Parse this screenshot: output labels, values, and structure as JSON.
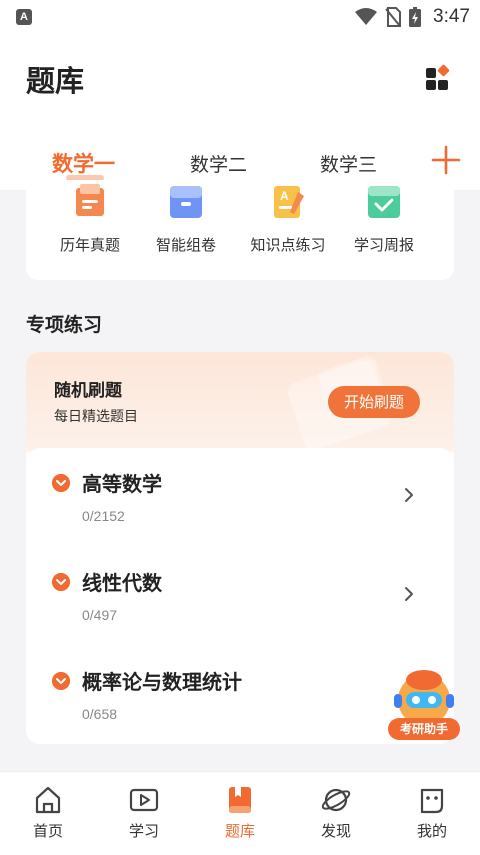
{
  "status_bar": {
    "time": "3:47",
    "app_indicator": "A"
  },
  "header": {
    "title": "题库"
  },
  "tabs": [
    {
      "label": "数学一",
      "active": true
    },
    {
      "label": "数学二",
      "active": false
    },
    {
      "label": "数学三",
      "active": false
    }
  ],
  "quick_actions": [
    {
      "label": "历年真题",
      "icon": "exam-paper-icon"
    },
    {
      "label": "智能组卷",
      "icon": "folder-box-icon"
    },
    {
      "label": "知识点练习",
      "icon": "notebook-a-icon"
    },
    {
      "label": "学习周报",
      "icon": "report-check-icon"
    }
  ],
  "section": {
    "title": "专项练习"
  },
  "random_practice": {
    "title": "随机刷题",
    "subtitle": "每日精选题目",
    "button_label": "开始刷题"
  },
  "subjects": [
    {
      "name": "高等数学",
      "progress": "0/2152"
    },
    {
      "name": "线性代数",
      "progress": "0/497"
    },
    {
      "name": "概率论与数理统计",
      "progress": "0/658"
    }
  ],
  "assistant": {
    "label": "考研助手"
  },
  "bottom_nav": [
    {
      "label": "首页",
      "icon": "home-icon",
      "active": false
    },
    {
      "label": "学习",
      "icon": "video-play-icon",
      "active": false
    },
    {
      "label": "题库",
      "icon": "bookmark-book-icon",
      "active": true
    },
    {
      "label": "发现",
      "icon": "planet-icon",
      "active": false
    },
    {
      "label": "我的",
      "icon": "profile-face-icon",
      "active": false
    }
  ],
  "colors": {
    "accent": "#f06a32",
    "accent_light": "#fde6d9"
  }
}
